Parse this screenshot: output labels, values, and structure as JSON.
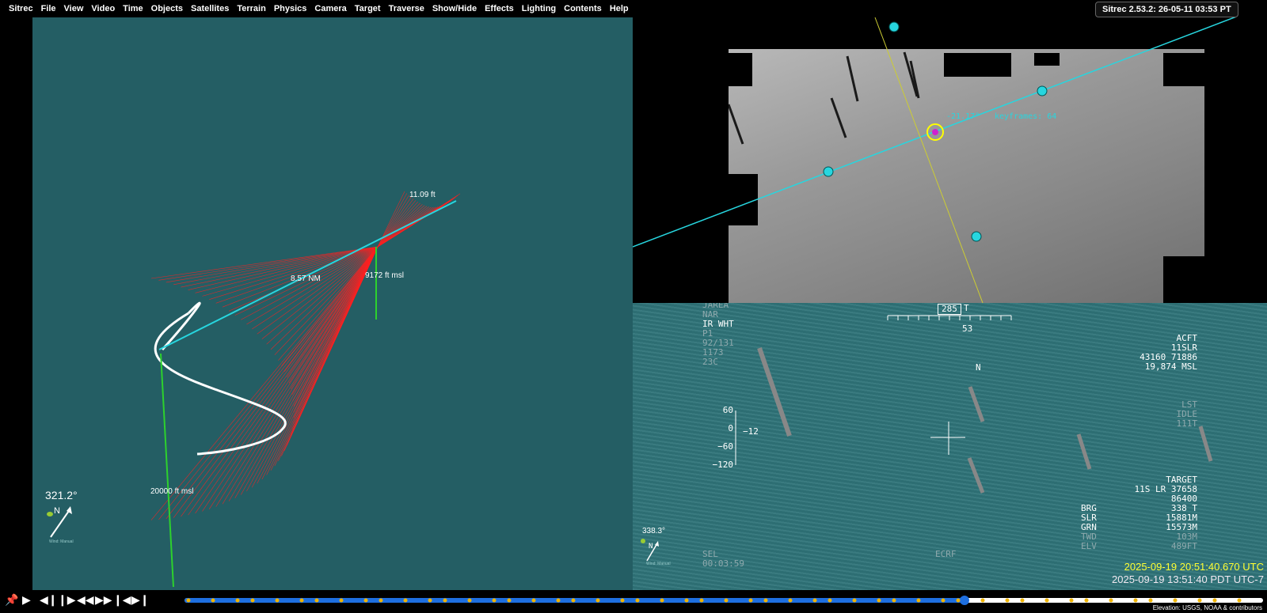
{
  "menu": {
    "items": [
      "Sitrec",
      "File",
      "View",
      "Video",
      "Time",
      "Objects",
      "Satellites",
      "Terrain",
      "Physics",
      "Camera",
      "Target",
      "Traverse",
      "Show/Hide",
      "Effects",
      "Lighting",
      "Contents",
      "Help"
    ]
  },
  "version_label": "Sitrec 2.53.2: 26-05-11 03:53 PT",
  "view3d": {
    "background": "#245e64",
    "label_distance_nm": "8.57 NM",
    "label_target_alt": "9172 ft msl",
    "label_small": "11.09 ft",
    "label_camera_alt": "20000 ft msl",
    "heading": "321.2°",
    "compass_n": "N",
    "compass_caption": "Wind: Manual"
  },
  "video_top": {
    "angle_label": "-21.17°",
    "keyframes_label": "keyframes: 64"
  },
  "hud": {
    "top_left": [
      "JAREA",
      "NAR",
      "IR WHT",
      "P1",
      "92/131",
      "1173",
      "23C"
    ],
    "top_left_dim": [
      true,
      true,
      false,
      true,
      true,
      true,
      true
    ],
    "heading_box": "285",
    "heading_suffix": "T",
    "heading_below": "53",
    "north": "N",
    "acft": [
      "ACFT",
      "11SLR",
      "43160 71886",
      "19,874 MSL"
    ],
    "lst": [
      "LST",
      "IDLE",
      "111T"
    ],
    "scale_labels": [
      "60",
      "0",
      "−60",
      "−120"
    ],
    "scale_value": "−12",
    "target_header": "TARGET",
    "target_lines": [
      "11S LR 37658",
      "86400"
    ],
    "target_rows": [
      {
        "k": "BRG",
        "v": "338 T",
        "dim": false
      },
      {
        "k": "SLR",
        "v": "15881M",
        "dim": false
      },
      {
        "k": "GRN",
        "v": "15573M",
        "dim": false
      },
      {
        "k": "TWD",
        "v": "103M",
        "dim": true
      },
      {
        "k": "ELV",
        "v": "489FT",
        "dim": true
      }
    ],
    "heading": "338.3°",
    "compass_n": "N",
    "compass_caption": "Wind: Manual",
    "sel": "SEL",
    "sel_time": "00:03:59",
    "ecrf": "ECRF",
    "timestamp_utc": "2025-09-19 20:51:40.670 UTC",
    "timestamp_local": "2025-09-19 13:51:40 PDT UTC-7"
  },
  "timeline": {
    "progress": 0.723,
    "attribution": "Elevation: USGS, NOAA & contributors"
  },
  "colors": {
    "accent": "#1e6fe0",
    "frustum": "#ff2020",
    "track": "#ffffff",
    "cyan": "#27d6df",
    "marker": "#f0b400"
  }
}
